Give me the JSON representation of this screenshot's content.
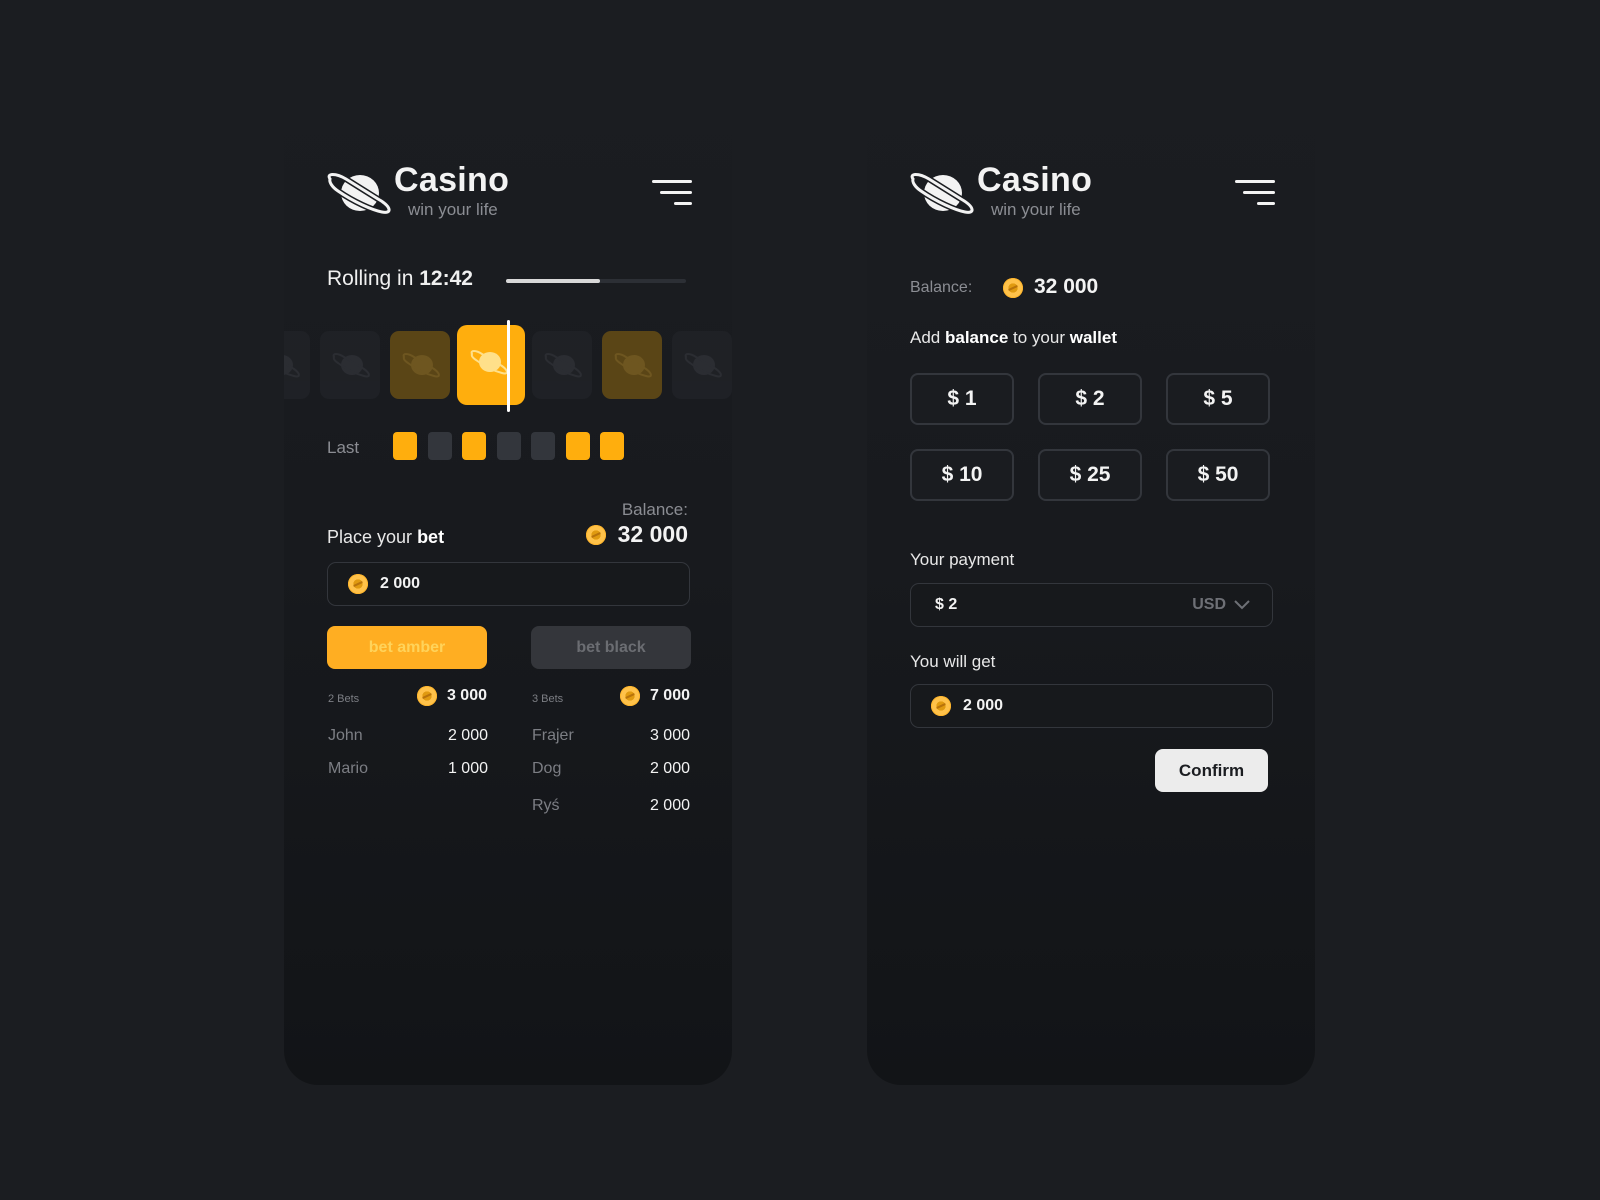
{
  "brand": {
    "title": "Casino",
    "subtitle": "win your life"
  },
  "colors": {
    "accent": "#ffae0d",
    "background": "#1b1d21",
    "neutral_square": "#33363c"
  },
  "left": {
    "rolling_prefix": "Rolling in",
    "rolling_time": "12:42",
    "progress_fraction": 0.52,
    "reels": [
      "dark",
      "dark",
      "amber-dim",
      "amber",
      "dark",
      "amber-dim",
      "dark"
    ],
    "last_label": "Last",
    "last_results": [
      "amber",
      "black",
      "amber",
      "black",
      "black",
      "amber",
      "amber"
    ],
    "balance_label": "Balance:",
    "balance_value": "32 000",
    "place_bet_prefix": "Place your",
    "place_bet_bold": "bet",
    "bet_input_value": "2 000",
    "bet_amber_label": "bet amber",
    "bet_black_label": "bet black",
    "amber_side": {
      "count": "2 Bets",
      "total": "3 000",
      "bettors": [
        {
          "name": "John",
          "amount": "2 000"
        },
        {
          "name": "Mario",
          "amount": "1 000"
        }
      ]
    },
    "black_side": {
      "count": "3 Bets",
      "total": "7 000",
      "bettors": [
        {
          "name": "Frajer",
          "amount": "3 000"
        },
        {
          "name": "Dog",
          "amount": "2 000"
        },
        {
          "name": "Ryś",
          "amount": "2 000"
        }
      ]
    }
  },
  "right": {
    "balance_label": "Balance:",
    "balance_value": "32 000",
    "add_prefix": "Add",
    "add_bold1": "balance",
    "add_middle": "to your",
    "add_bold2": "wallet",
    "amounts": [
      "$ 1",
      "$ 2",
      "$ 5",
      "$ 10",
      "$ 25",
      "$ 50"
    ],
    "payment_label": "Your payment",
    "payment_value": "$ 2",
    "currency": "USD",
    "get_label": "You will get",
    "get_value": "2 000",
    "confirm_label": "Confirm"
  }
}
